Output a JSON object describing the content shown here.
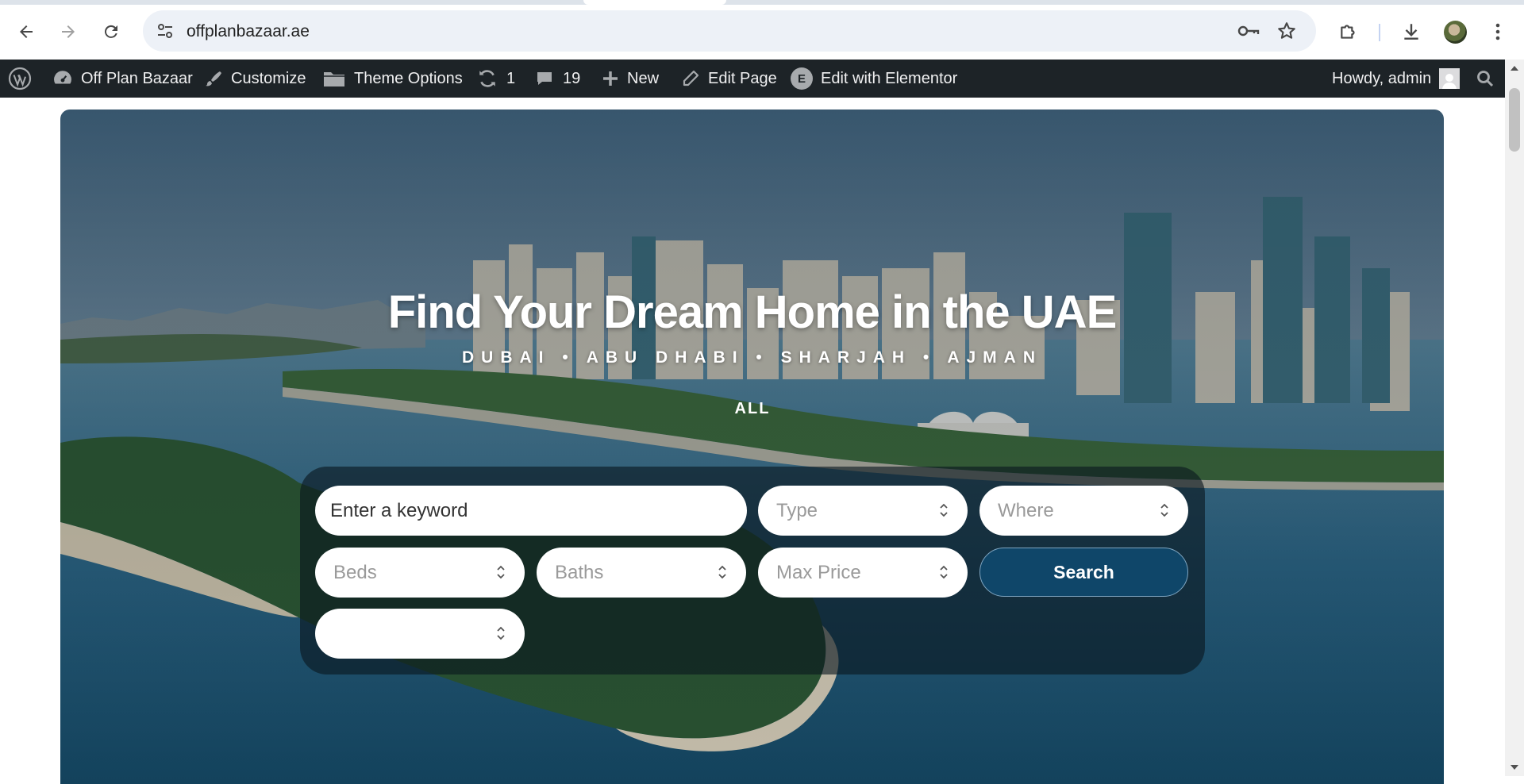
{
  "browser": {
    "url": "offplanbazaar.ae",
    "back_icon": "arrow-left-icon",
    "forward_icon": "arrow-right-icon",
    "reload_icon": "reload-icon"
  },
  "admin_bar": {
    "site_name": "Off Plan Bazaar",
    "customize": "Customize",
    "theme_options": "Theme Options",
    "updates_count": "1",
    "comments_count": "19",
    "new": "New",
    "edit_page": "Edit Page",
    "elementor": "Edit with Elementor",
    "elementor_icon_letter": "E",
    "greeting": "Howdy, admin"
  },
  "hero": {
    "title": "Find Your Dream Home in the UAE",
    "subtitle": "DUBAI • ABU DHABI • SHARJAH • AJMAN",
    "active_tab": "ALL"
  },
  "search": {
    "keyword_placeholder": "Enter a keyword",
    "type": "Type",
    "where": "Where",
    "beds": "Beds",
    "baths": "Baths",
    "max_price": "Max Price",
    "extra": "",
    "button": "Search"
  },
  "colors": {
    "admin_bar": "#1d2327",
    "search_button": "#0f4669",
    "omnibox": "#edf1f7"
  }
}
